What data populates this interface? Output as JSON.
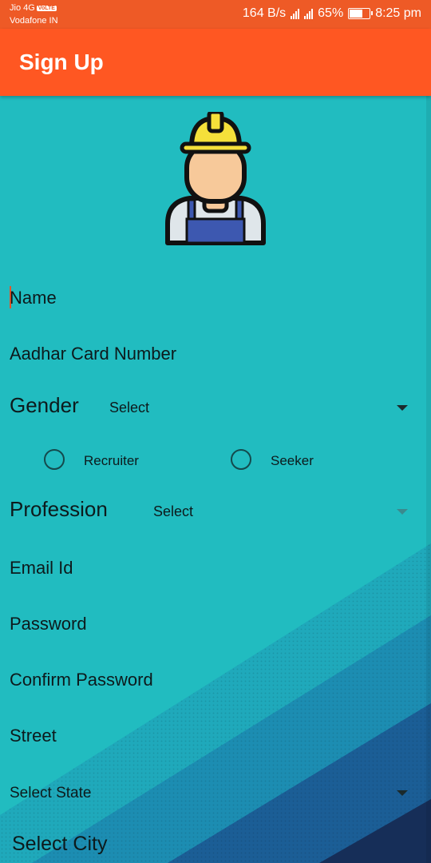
{
  "status_bar": {
    "carrier_1": "Jio 4G",
    "volte_badge": "VoLTE",
    "carrier_2": "Vodafone IN",
    "network_speed": "164 B/s",
    "battery_percent": "65%",
    "time": "8:25 pm"
  },
  "app_bar": {
    "title": "Sign Up"
  },
  "form": {
    "name_placeholder": "Name",
    "aadhar_placeholder": "Aadhar Card Number",
    "gender_label": "Gender",
    "gender_value": "Select",
    "role_options": [
      {
        "label": "Recruiter",
        "selected": false
      },
      {
        "label": "Seeker",
        "selected": false
      }
    ],
    "profession_label": "Profession",
    "profession_value": "Select",
    "email_placeholder": "Email Id",
    "password_placeholder": "Password",
    "confirm_password_placeholder": "Confirm Password",
    "street_placeholder": "Street",
    "state_value": "Select State",
    "city_value": "Select City"
  },
  "colors": {
    "status_bar": "#ee5a26",
    "app_bar": "#ff5722",
    "background": "#21bcc0",
    "accent": "#e2562a"
  },
  "icons": {
    "avatar": "construction-worker-icon",
    "dropdown": "triangle-down-icon"
  }
}
